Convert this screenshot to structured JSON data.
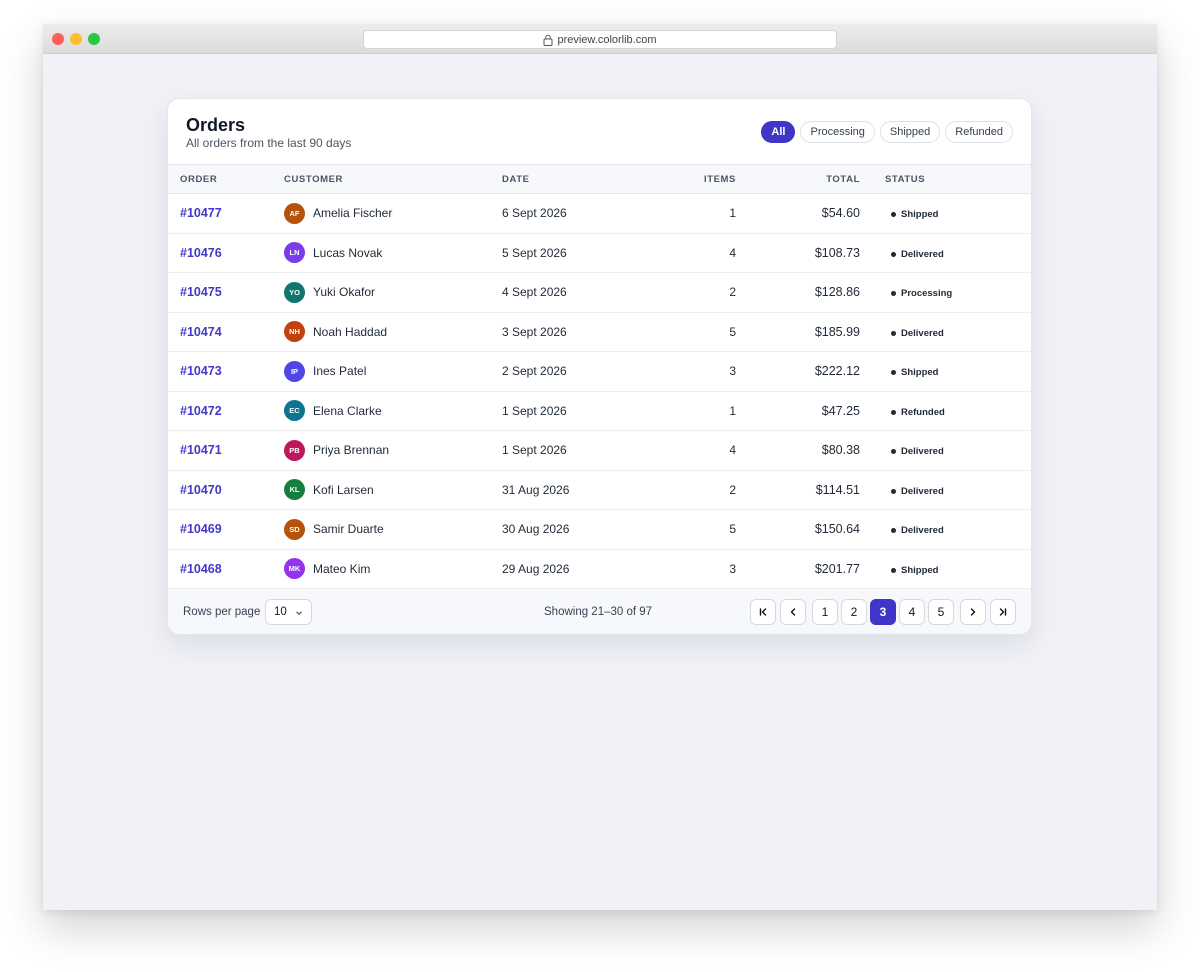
{
  "browser": {
    "url": "preview.colorlib.com"
  },
  "header": {
    "title": "Orders",
    "subtitle": "All orders from the last 90 days"
  },
  "filters": [
    {
      "label": "All",
      "active": true
    },
    {
      "label": "Processing",
      "active": false
    },
    {
      "label": "Shipped",
      "active": false
    },
    {
      "label": "Refunded",
      "active": false
    }
  ],
  "table": {
    "columns": {
      "order": "ORDER",
      "customer": "CUSTOMER",
      "date": "DATE",
      "items": "ITEMS",
      "total": "TOTAL",
      "status": "STATUS"
    },
    "rows": [
      {
        "order": "#10477",
        "initials": "AF",
        "avatar_color": "#b45309",
        "customer": "Amelia Fischer",
        "date": "6 Sept 2026",
        "items": "1",
        "total": "$54.60",
        "status": "Shipped"
      },
      {
        "order": "#10476",
        "initials": "LN",
        "avatar_color": "#7c3aed",
        "customer": "Lucas Novak",
        "date": "5 Sept 2026",
        "items": "4",
        "total": "$108.73",
        "status": "Delivered"
      },
      {
        "order": "#10475",
        "initials": "YO",
        "avatar_color": "#0f766e",
        "customer": "Yuki Okafor",
        "date": "4 Sept 2026",
        "items": "2",
        "total": "$128.86",
        "status": "Processing"
      },
      {
        "order": "#10474",
        "initials": "NH",
        "avatar_color": "#c2410c",
        "customer": "Noah Haddad",
        "date": "3 Sept 2026",
        "items": "5",
        "total": "$185.99",
        "status": "Delivered"
      },
      {
        "order": "#10473",
        "initials": "IP",
        "avatar_color": "#4f46e5",
        "customer": "Ines Patel",
        "date": "2 Sept 2026",
        "items": "3",
        "total": "$222.12",
        "status": "Shipped"
      },
      {
        "order": "#10472",
        "initials": "EC",
        "avatar_color": "#0e7490",
        "customer": "Elena Clarke",
        "date": "1 Sept 2026",
        "items": "1",
        "total": "$47.25",
        "status": "Refunded"
      },
      {
        "order": "#10471",
        "initials": "PB",
        "avatar_color": "#be185d",
        "customer": "Priya Brennan",
        "date": "1 Sept 2026",
        "items": "4",
        "total": "$80.38",
        "status": "Delivered"
      },
      {
        "order": "#10470",
        "initials": "KL",
        "avatar_color": "#15803d",
        "customer": "Kofi Larsen",
        "date": "31 Aug 2026",
        "items": "2",
        "total": "$114.51",
        "status": "Delivered"
      },
      {
        "order": "#10469",
        "initials": "SD",
        "avatar_color": "#b45309",
        "customer": "Samir Duarte",
        "date": "30 Aug 2026",
        "items": "5",
        "total": "$150.64",
        "status": "Delivered"
      },
      {
        "order": "#10468",
        "initials": "MK",
        "avatar_color": "#9333ea",
        "customer": "Mateo Kim",
        "date": "29 Aug 2026",
        "items": "3",
        "total": "$201.77",
        "status": "Shipped"
      }
    ]
  },
  "footer": {
    "rows_per_page_label": "Rows per page",
    "rows_per_page_value": "10",
    "showing": "Showing 21–30 of 97",
    "pages": [
      "1",
      "2",
      "3",
      "4",
      "5"
    ],
    "current_page": "3"
  },
  "colors": {
    "accent": "#3f35c6",
    "link": "#4338ca"
  }
}
